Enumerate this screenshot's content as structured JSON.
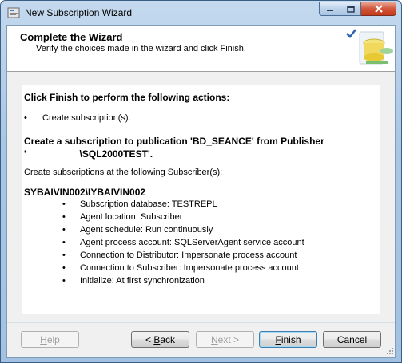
{
  "window": {
    "title": "New Subscription Wizard"
  },
  "header": {
    "title": "Complete the Wizard",
    "subtitle": "Verify the choices made in the wizard and click Finish."
  },
  "report": {
    "heading": "Click Finish to perform the following actions:",
    "action_item": "Create subscription(s).",
    "publication_line1": "Create a subscription to publication 'BD_SEANCE' from Publisher",
    "publication_line2": "'                    \\SQL2000TEST'.",
    "subscribers_label": "Create subscriptions at the following Subscriber(s):",
    "subscriber_name": "SYBAIVIN002\\IYBAIVIN002",
    "subscriber_details": [
      "Subscription database: TESTREPL",
      "Agent location: Subscriber",
      "Agent schedule: Run continuously",
      "Agent process account: SQLServerAgent service account",
      "Connection to Distributor: Impersonate process account",
      "Connection to Subscriber: Impersonate process account",
      "Initialize: At first synchronization"
    ]
  },
  "buttons": {
    "help": {
      "pre": "",
      "mnemonic": "H",
      "post": "elp"
    },
    "back": {
      "pre": "< ",
      "mnemonic": "B",
      "post": "ack"
    },
    "next": {
      "pre": "",
      "mnemonic": "N",
      "post": "ext >"
    },
    "finish": {
      "pre": "",
      "mnemonic": "F",
      "post": "inish"
    },
    "cancel": {
      "pre": "Cancel",
      "mnemonic": "",
      "post": ""
    }
  },
  "colors": {
    "accent": "#3c7fb1",
    "close": "#c23b1b"
  },
  "icons": [
    "app-wizard-icon",
    "minimize-icon",
    "maximize-icon",
    "close-icon",
    "wizard-graphic-icon",
    "bullet-icon",
    "resize-grip-icon"
  ]
}
